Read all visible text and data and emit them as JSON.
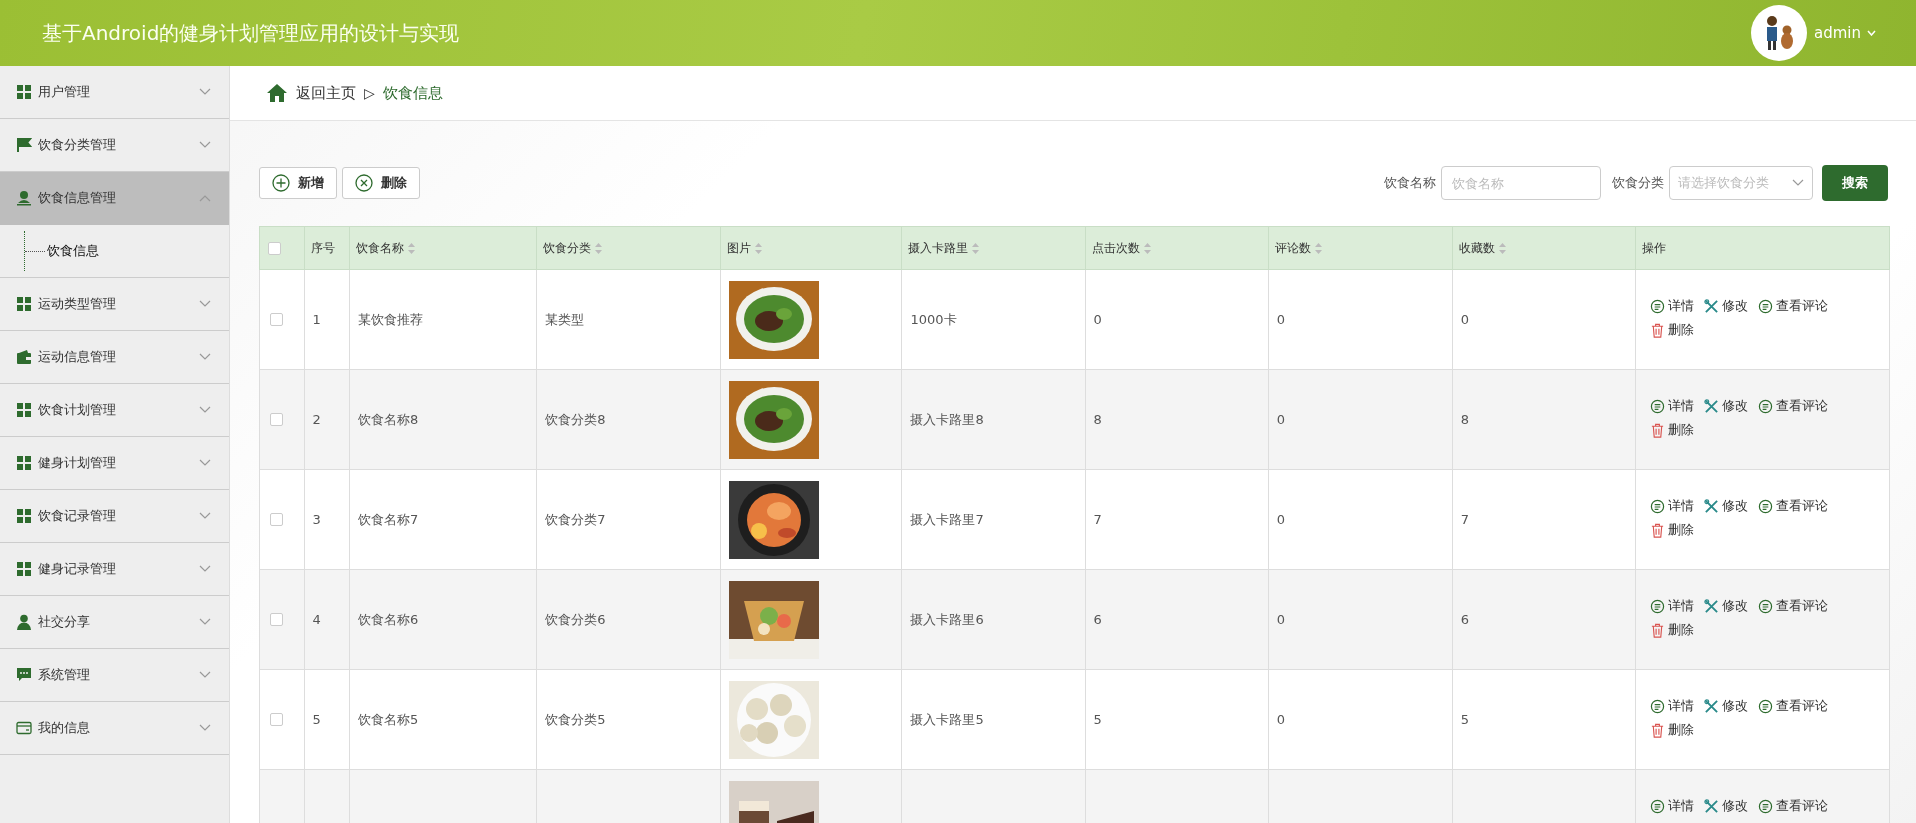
{
  "header": {
    "title": "基于Android的健身计划管理应用的设计与实现",
    "user": "admin",
    "user_menu_open": false
  },
  "sidebar": {
    "items": [
      {
        "label": "用户管理",
        "kind": "grid",
        "expanded": false,
        "selected": false
      },
      {
        "label": "饮食分类管理",
        "kind": "flag",
        "expanded": false,
        "selected": false
      },
      {
        "label": "饮食信息管理",
        "kind": "user",
        "expanded": true,
        "selected": true,
        "children": [
          {
            "label": "饮食信息"
          }
        ]
      },
      {
        "label": "运动类型管理",
        "kind": "grid",
        "expanded": false,
        "selected": false
      },
      {
        "label": "运动信息管理",
        "kind": "wallet",
        "expanded": false,
        "selected": false
      },
      {
        "label": "饮食计划管理",
        "kind": "grid",
        "expanded": false,
        "selected": false
      },
      {
        "label": "健身计划管理",
        "kind": "grid",
        "expanded": false,
        "selected": false
      },
      {
        "label": "饮食记录管理",
        "kind": "grid",
        "expanded": false,
        "selected": false
      },
      {
        "label": "健身记录管理",
        "kind": "grid",
        "expanded": false,
        "selected": false
      },
      {
        "label": "社交分享",
        "kind": "person",
        "expanded": false,
        "selected": false
      },
      {
        "label": "系统管理",
        "kind": "chat",
        "expanded": false,
        "selected": false
      },
      {
        "label": "我的信息",
        "kind": "card",
        "expanded": false,
        "selected": false
      }
    ]
  },
  "breadcrumb": {
    "home": "返回主页",
    "separator": "▷",
    "current": "饮食信息"
  },
  "toolbar": {
    "buttons": [
      {
        "label": "新增",
        "kind": "add"
      },
      {
        "label": "删除",
        "kind": "delete"
      }
    ],
    "filters": [
      {
        "label": "饮食名称",
        "placeholder": "饮食名称",
        "kind": "input"
      },
      {
        "label": "饮食分类",
        "placeholder": "请选择饮食分类",
        "kind": "select"
      }
    ],
    "search_button": "搜索"
  },
  "table": {
    "select_all": {
      "checked": false
    },
    "columns": [
      {
        "label": "序号",
        "sortable": false
      },
      {
        "label": "饮食名称",
        "sortable": true
      },
      {
        "label": "饮食分类",
        "sortable": true
      },
      {
        "label": "图片",
        "sortable": true
      },
      {
        "label": "摄入卡路里",
        "sortable": true
      },
      {
        "label": "点击次数",
        "sortable": true
      },
      {
        "label": "评论数",
        "sortable": true
      },
      {
        "label": "收藏数",
        "sortable": true
      },
      {
        "label": "操作",
        "sortable": false
      }
    ],
    "rows": [
      {
        "checked": false,
        "index": "1",
        "name": "某饮食推荐",
        "category": "某类型",
        "picture": {
          "kind": "greens"
        },
        "calories": "1000卡",
        "clicks": "0",
        "comments": "0",
        "favorites": "0",
        "actions": [
          {
            "label": "详情",
            "kind": "detail"
          },
          {
            "label": "修改",
            "kind": "edit"
          },
          {
            "label": "查看评论",
            "kind": "comments"
          },
          {
            "label": "删除",
            "kind": "delete"
          }
        ]
      },
      {
        "checked": false,
        "index": "2",
        "name": "饮食名称8",
        "category": "饮食分类8",
        "picture": {
          "kind": "greens"
        },
        "calories": "摄入卡路里8",
        "clicks": "8",
        "comments": "0",
        "favorites": "8",
        "actions": [
          {
            "label": "详情",
            "kind": "detail"
          },
          {
            "label": "修改",
            "kind": "edit"
          },
          {
            "label": "查看评论",
            "kind": "comments"
          },
          {
            "label": "删除",
            "kind": "delete"
          }
        ]
      },
      {
        "checked": false,
        "index": "3",
        "name": "饮食名称7",
        "category": "饮食分类7",
        "picture": {
          "kind": "bowl"
        },
        "calories": "摄入卡路里7",
        "clicks": "7",
        "comments": "0",
        "favorites": "7",
        "actions": [
          {
            "label": "详情",
            "kind": "detail"
          },
          {
            "label": "修改",
            "kind": "edit"
          },
          {
            "label": "查看评论",
            "kind": "comments"
          },
          {
            "label": "删除",
            "kind": "delete"
          }
        ]
      },
      {
        "checked": false,
        "index": "4",
        "name": "饮食名称6",
        "category": "饮食分类6",
        "picture": {
          "kind": "salad"
        },
        "calories": "摄入卡路里6",
        "clicks": "6",
        "comments": "0",
        "favorites": "6",
        "actions": [
          {
            "label": "详情",
            "kind": "detail"
          },
          {
            "label": "修改",
            "kind": "edit"
          },
          {
            "label": "查看评论",
            "kind": "comments"
          },
          {
            "label": "删除",
            "kind": "delete"
          }
        ]
      },
      {
        "checked": false,
        "index": "5",
        "name": "饮食名称5",
        "category": "饮食分类5",
        "picture": {
          "kind": "dumplings"
        },
        "calories": "摄入卡路里5",
        "clicks": "5",
        "comments": "0",
        "favorites": "5",
        "actions": [
          {
            "label": "详情",
            "kind": "detail"
          },
          {
            "label": "修改",
            "kind": "edit"
          },
          {
            "label": "查看评论",
            "kind": "comments"
          },
          {
            "label": "删除",
            "kind": "delete"
          }
        ]
      },
      {
        "picture": {
          "kind": "cake"
        },
        "actions": [
          {
            "label": "详情",
            "kind": "detail"
          },
          {
            "label": "修改",
            "kind": "edit"
          },
          {
            "label": "查看评论",
            "kind": "comments"
          }
        ]
      }
    ]
  }
}
